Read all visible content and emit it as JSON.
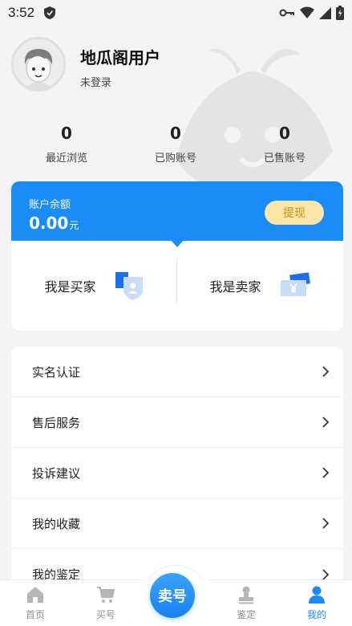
{
  "status_bar": {
    "time": "3:52"
  },
  "profile": {
    "username": "地瓜阁用户",
    "login_status": "未登录"
  },
  "stats": [
    {
      "value": "0",
      "label": "最近浏览"
    },
    {
      "value": "0",
      "label": "已购账号"
    },
    {
      "value": "0",
      "label": "已售账号"
    }
  ],
  "wallet": {
    "balance_label": "账户余额",
    "balance": "0.00",
    "unit": "元",
    "withdraw_label": "提现",
    "buyer_label": "我是买家",
    "seller_label": "我是卖家"
  },
  "menu": [
    {
      "label": "实名认证"
    },
    {
      "label": "售后服务"
    },
    {
      "label": "投诉建议"
    },
    {
      "label": "我的收藏"
    },
    {
      "label": "我的鉴定"
    }
  ],
  "nav": {
    "home": "首页",
    "buy": "买号",
    "sell": "卖号",
    "appraise": "鉴定",
    "mine": "我的"
  },
  "colors": {
    "accent": "#1a8cf6",
    "withdraw_bg": "#fbe6a7",
    "withdraw_text": "#c99116"
  }
}
